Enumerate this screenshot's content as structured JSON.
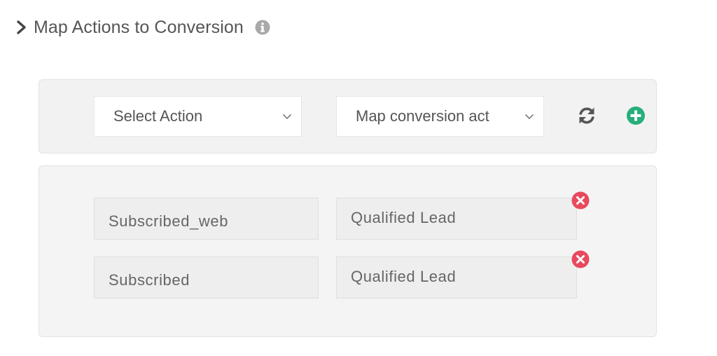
{
  "header": {
    "title": "Map Actions to Conversion",
    "expand_icon": "chevron-right-icon",
    "info_icon": "info-circle-icon"
  },
  "controls": {
    "select_action": {
      "value": "Select Action"
    },
    "map_conversion": {
      "value": "Map conversion act"
    },
    "refresh_icon": "refresh-icon",
    "add_icon": "plus-circle-icon"
  },
  "mappings": [
    {
      "action": "Subscribed_web",
      "conversion": "Qualified Lead"
    },
    {
      "action": "Subscribed",
      "conversion": "Qualified Lead"
    }
  ],
  "colors": {
    "add": "#27ae7a",
    "remove": "#e8495e",
    "text": "#555555",
    "panel": "#f2f2f2"
  }
}
